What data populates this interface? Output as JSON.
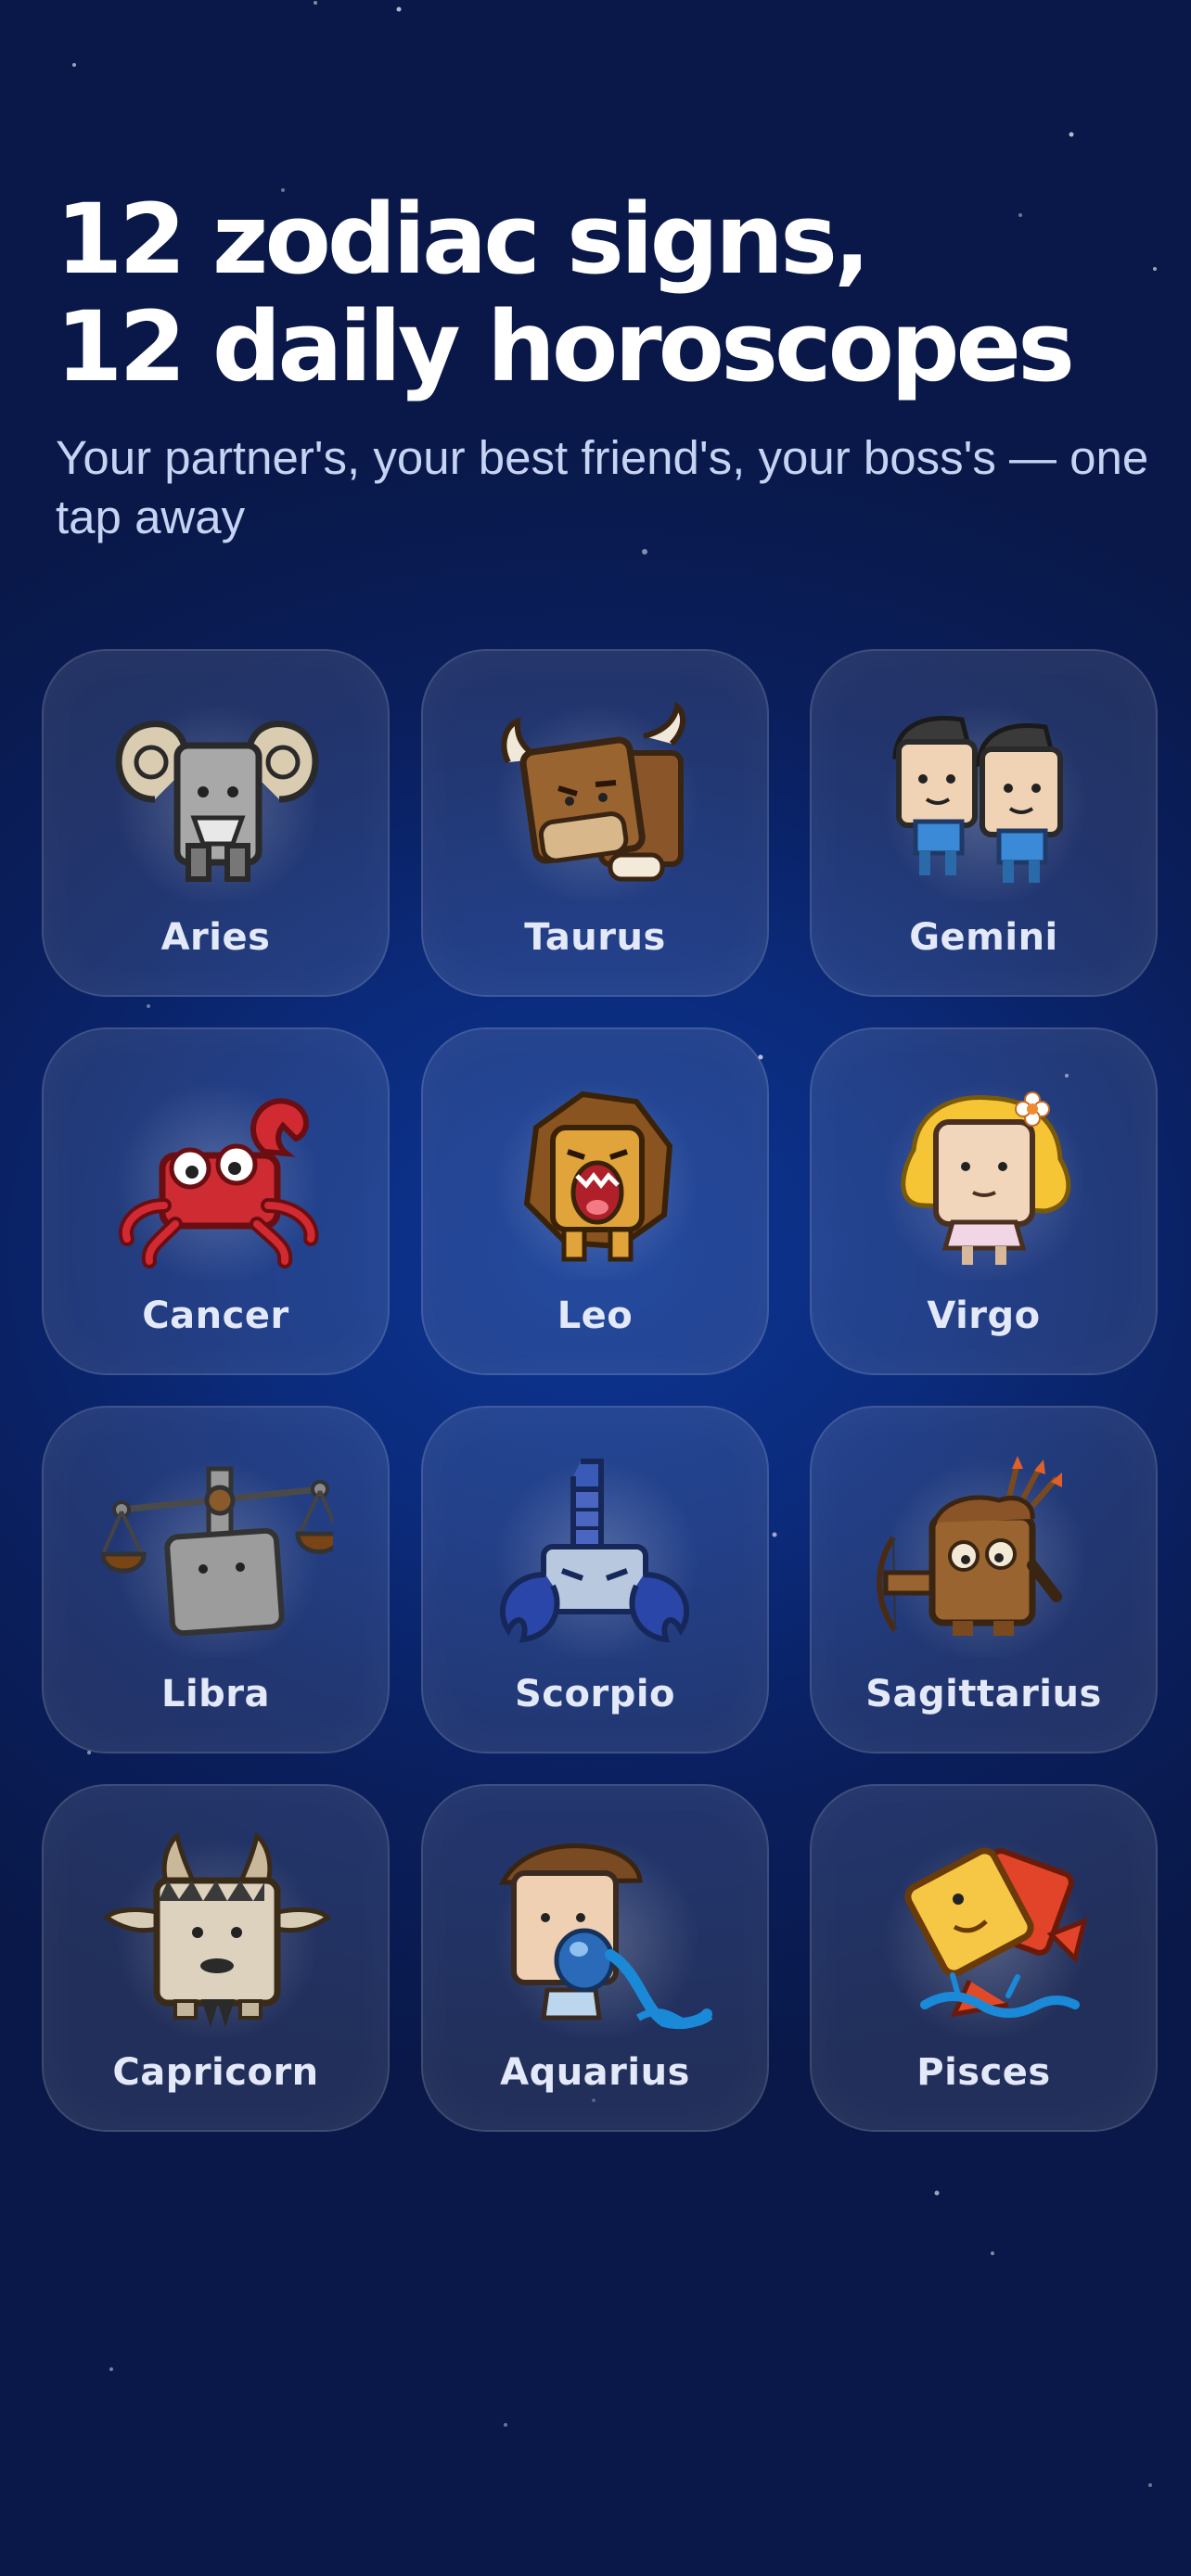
{
  "header": {
    "title_line1": "12 zodiac signs,",
    "title_line2": "12 daily horoscopes",
    "subtitle": "Your partner's, your best friend's, your boss's — one tap away"
  },
  "signs": [
    {
      "label": "Aries",
      "icon": "ram-icon"
    },
    {
      "label": "Taurus",
      "icon": "bull-icon"
    },
    {
      "label": "Gemini",
      "icon": "twins-icon"
    },
    {
      "label": "Cancer",
      "icon": "crab-icon"
    },
    {
      "label": "Leo",
      "icon": "lion-icon"
    },
    {
      "label": "Virgo",
      "icon": "maiden-icon"
    },
    {
      "label": "Libra",
      "icon": "scales-icon"
    },
    {
      "label": "Scorpio",
      "icon": "scorpion-icon"
    },
    {
      "label": "Sagittarius",
      "icon": "archer-icon"
    },
    {
      "label": "Capricorn",
      "icon": "goat-icon"
    },
    {
      "label": "Aquarius",
      "icon": "water-bearer-icon"
    },
    {
      "label": "Pisces",
      "icon": "fish-icon"
    }
  ],
  "colors": {
    "background": "#0a1f5e",
    "card": "rgba(255,255,255,0.10)",
    "title": "#ffffff",
    "subtitle": "#c6d3f2"
  }
}
